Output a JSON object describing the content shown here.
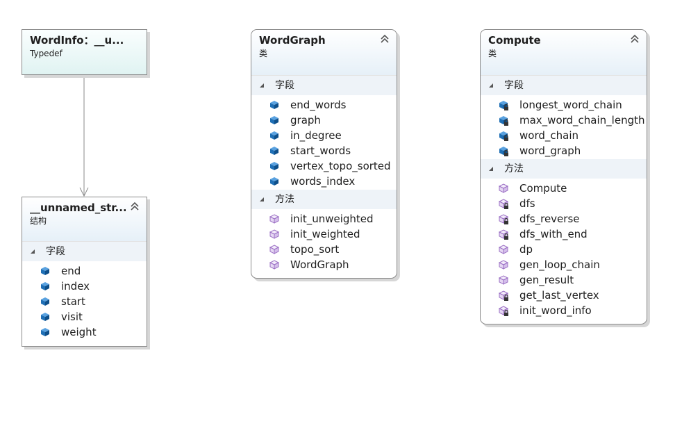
{
  "classes": {
    "wordinfo": {
      "title": "WordInfo：__u...",
      "kind": "Typedef"
    },
    "unnamed": {
      "title": "__unnamed_str...",
      "kind": "结构",
      "fields_label": "字段",
      "fields": [
        "end",
        "index",
        "start",
        "visit",
        "weight"
      ]
    },
    "wordgraph": {
      "title": "WordGraph",
      "kind": "类",
      "fields_label": "字段",
      "fields": [
        "end_words",
        "graph",
        "in_degree",
        "start_words",
        "vertex_topo_sorted",
        "words_index"
      ],
      "methods_label": "方法",
      "methods": [
        "init_unweighted",
        "init_weighted",
        "topo_sort",
        "WordGraph"
      ]
    },
    "compute": {
      "title": "Compute",
      "kind": "类",
      "fields_label": "字段",
      "fields": [
        "longest_word_chain",
        "max_word_chain_length",
        "word_chain",
        "word_graph"
      ],
      "methods_label": "方法",
      "methods": [
        "Compute",
        "dfs",
        "dfs_reverse",
        "dfs_with_end",
        "dp",
        "gen_loop_chain",
        "gen_result",
        "get_last_vertex",
        "init_word_info"
      ]
    }
  },
  "icons": {
    "field_public": "field-icon",
    "field_private": "private-field-icon",
    "method_public": "method-icon",
    "method_private": "private-method-icon",
    "collapse": "chevron-double-up-icon",
    "expanded": "triangle-expanded-icon"
  },
  "colors": {
    "field_blue": "#1f6fb5",
    "method_purple": "#9b6fc4",
    "section_bg": "#eef3f8",
    "typedef_bg": "#e0f3f2"
  },
  "visibility": {
    "compute_methods_private": [
      false,
      true,
      true,
      true,
      false,
      false,
      false,
      true,
      true
    ]
  }
}
